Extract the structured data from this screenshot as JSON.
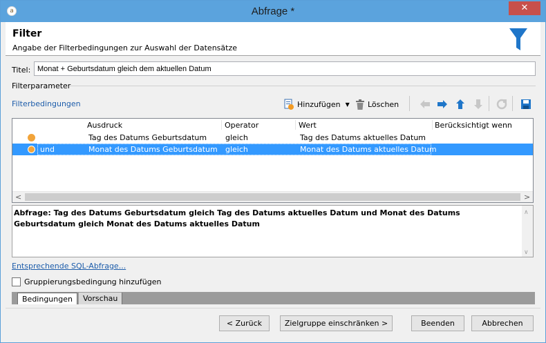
{
  "window": {
    "title": "Abfrage *",
    "close_glyph": "✕"
  },
  "header": {
    "heading": "Filter",
    "subheading": "Angabe der Filterbedingungen zur Auswahl der Datensätze",
    "icon": "funnel-icon"
  },
  "title_field": {
    "label": "Titel:",
    "value": "Monat + Geburtsdatum gleich dem aktuellen Datum"
  },
  "filter_params": {
    "group_label": "Filterparameter",
    "toolbar": {
      "title": "Filterbedingungen",
      "add_label": "Hinzufügen",
      "delete_label": "Löschen"
    },
    "columns": [
      "Ausdruck",
      "Operator",
      "Wert",
      "Berücksichtigt wenn"
    ],
    "rows": [
      {
        "connector": "",
        "expression": "Tag des Datums Geburtsdatum",
        "operator": "gleich",
        "value": "Tag des Datums aktuelles Datum",
        "condition": ""
      },
      {
        "connector": "und",
        "expression": "Monat des Datums Geburtsdatum",
        "operator": "gleich",
        "value": "Monat des Datums aktuelles Datum",
        "condition": ""
      }
    ]
  },
  "summary": {
    "text": "Abfrage: Tag des Datums Geburtsdatum gleich Tag des Datums aktuelles Datum und Monat des Datums Geburtsdatum gleich Monat des Datums aktuelles Datum"
  },
  "sql_link": "Entsprechende SQL-Abfrage...",
  "grouping_checkbox": {
    "label": "Gruppierungsbedingung hinzufügen",
    "checked": false
  },
  "tabs": [
    {
      "label": "Bedingungen",
      "active": true
    },
    {
      "label": "Vorschau",
      "active": false
    }
  ],
  "buttons": {
    "back": "< Zurück",
    "next": "Zielgruppe einschränken >",
    "finish": "Beenden",
    "cancel": "Abbrechen"
  },
  "colors": {
    "titlebar": "#5ba3dd",
    "selection": "#3399ff",
    "link": "#1c5caa",
    "close": "#c7504b",
    "condition_dot": "#f2a43a"
  }
}
